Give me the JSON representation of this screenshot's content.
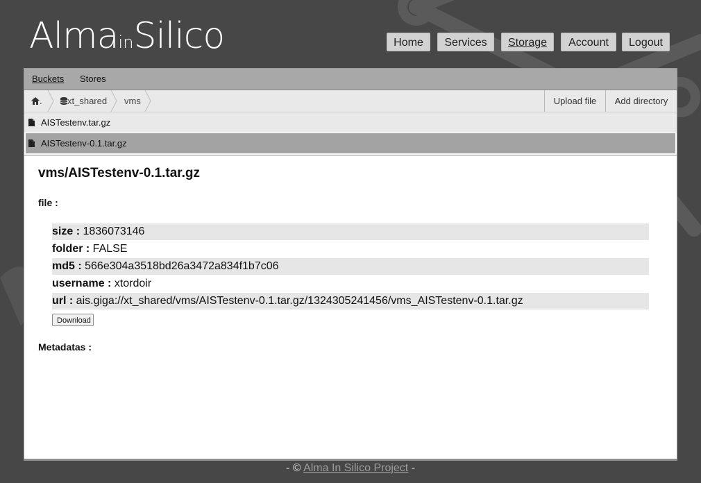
{
  "logo": {
    "part1": "Alma",
    "part2": "in",
    "part3": "Silico"
  },
  "nav": {
    "items": [
      {
        "label": "Home"
      },
      {
        "label": "Services"
      },
      {
        "label": "Storage"
      },
      {
        "label": "Account"
      },
      {
        "label": "Logout"
      }
    ],
    "active": "Storage"
  },
  "tabs": [
    {
      "label": "Buckets"
    },
    {
      "label": "Stores"
    }
  ],
  "breadcrumb": {
    "home_suffix": ".",
    "items": [
      {
        "label": "xt_shared",
        "icon": "database-icon"
      },
      {
        "label": "vms"
      }
    ],
    "actions": [
      {
        "label": "Upload file"
      },
      {
        "label": "Add directory"
      }
    ]
  },
  "files": [
    {
      "name": "AISTestenv.tar.gz",
      "icon": "file-icon"
    },
    {
      "name": "AISTestenv-0.1.tar.gz",
      "icon": "file-icon",
      "selected": true
    }
  ],
  "detail": {
    "title": "vms/AISTestenv-0.1.tar.gz",
    "file_label": "file :",
    "props": [
      {
        "key": "size :",
        "value": "1836073146"
      },
      {
        "key": "folder :",
        "value": "FALSE"
      },
      {
        "key": "md5 :",
        "value": "566e304a3518bd26a3472a834f1b7c06"
      },
      {
        "key": "username :",
        "value": "xtordoir"
      },
      {
        "key": "url :",
        "value": "ais.giga://xt_shared/vms/AISTestenv-0.1.tar.gz/1324305241456/vms_AISTestenv-0.1.tar.gz"
      }
    ],
    "download_label": "Download",
    "metadatas_label": "Metadatas :"
  },
  "footer": {
    "prefix": "- © ",
    "link": "Alma In Silico Project",
    "suffix": " -"
  },
  "colors": {
    "background": "#474747",
    "panel": "#ffffff",
    "tabbar": "#a8a8a8",
    "selected_row": "#a3a3a3",
    "nav_button": "#d2d2d2"
  }
}
